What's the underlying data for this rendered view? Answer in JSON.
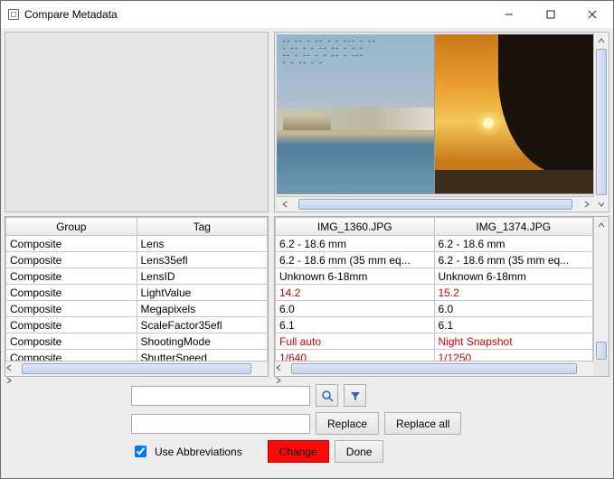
{
  "window": {
    "title": "Compare Metadata"
  },
  "columns": {
    "group": "Group",
    "tag": "Tag",
    "file_a": "IMG_1360.JPG",
    "file_b": "IMG_1374.JPG"
  },
  "rows": [
    {
      "group": "Composite",
      "tag": "Lens",
      "a": "6.2 - 18.6 mm",
      "b": "6.2 - 18.6 mm",
      "diff": false
    },
    {
      "group": "Composite",
      "tag": "Lens35efl",
      "a": "6.2 - 18.6 mm (35 mm eq...",
      "b": "6.2 - 18.6 mm (35 mm eq...",
      "diff": false
    },
    {
      "group": "Composite",
      "tag": "LensID",
      "a": "Unknown 6-18mm",
      "b": "Unknown 6-18mm",
      "diff": false
    },
    {
      "group": "Composite",
      "tag": "LightValue",
      "a": "14.2",
      "b": "15.2",
      "diff": true
    },
    {
      "group": "Composite",
      "tag": "Megapixels",
      "a": "6.0",
      "b": "6.0",
      "diff": false
    },
    {
      "group": "Composite",
      "tag": "ScaleFactor35efl",
      "a": "6.1",
      "b": "6.1",
      "diff": false
    },
    {
      "group": "Composite",
      "tag": "ShootingMode",
      "a": "Full auto",
      "b": "Night Snapshot",
      "diff": true
    },
    {
      "group": "Composite",
      "tag": "ShutterSpeed",
      "a": "1/640",
      "b": "1/1250",
      "diff": true
    }
  ],
  "controls": {
    "search_ph": "",
    "replace_input": "",
    "replace_btn": "Replace",
    "replace_all_btn": "Replace all",
    "abbrev_cb": "Use Abbreviations",
    "abbrev_checked": true,
    "change_btn": "Change",
    "done_btn": "Done"
  }
}
